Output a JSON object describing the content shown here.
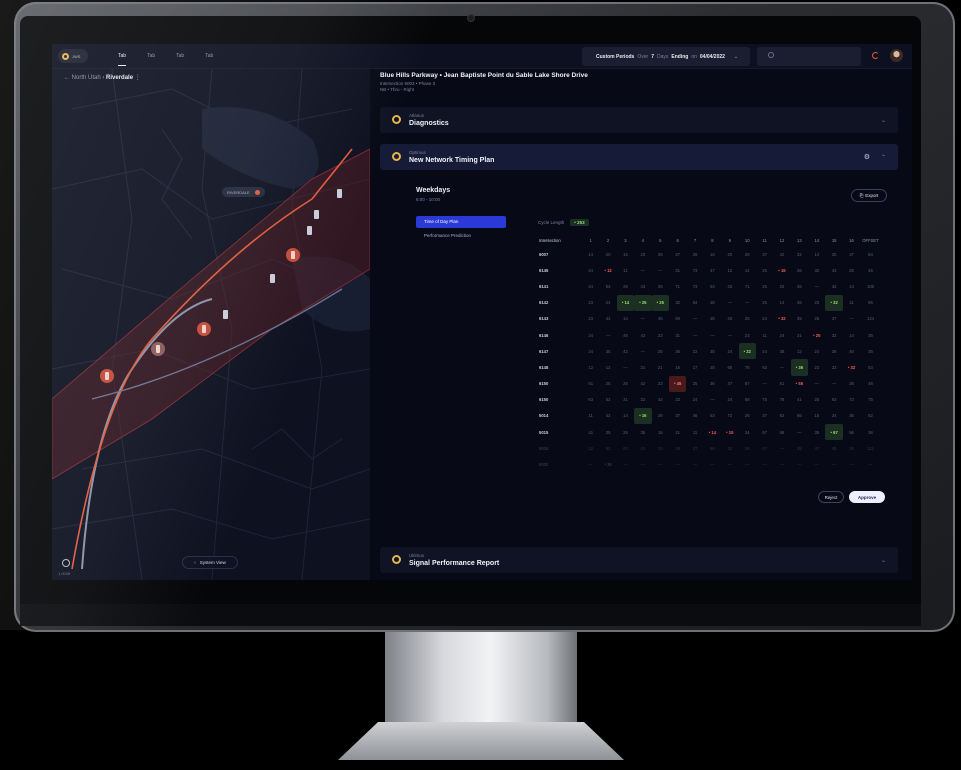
{
  "topbar": {
    "logo_text": "JWS",
    "tabs": [
      "Tab",
      "Tab",
      "Tab",
      "Tab"
    ],
    "period": {
      "label": "Custom Periods",
      "over": "Over",
      "days_value": "7",
      "days_unit": "Days",
      "ending": "Ending",
      "on": "on",
      "date": "04/04/2022"
    },
    "search_placeholder": ""
  },
  "map": {
    "breadcrumb_parent": "North Utah",
    "breadcrumb_current": "Riverdale",
    "region_label": "RIVERDALE",
    "system_view_button": "System View",
    "scale": "1,000ft"
  },
  "header": {
    "title": "Blue Hills Parkway  •  Jean Baptiste Point du Sable Lake Shore Drive",
    "subtitle1": "Intersection 5003  •  Phase 3",
    "subtitle2": "NB • Thru - Right"
  },
  "panels": [
    {
      "overline": "Atlanus",
      "title": "Diagnostics"
    },
    {
      "overline": "Optimus",
      "title": "New Network Timing Plan"
    },
    {
      "overline": "Ultimus",
      "title": "Signal Performance Report"
    }
  ],
  "plan": {
    "title": "Weekdays",
    "time": "6:00 - 10:00",
    "export_label": "Export",
    "side_items": [
      "Time of Day Plan",
      "Performance Prediction"
    ],
    "cycle_label": "Cycle Length",
    "cycle_value": "• 253",
    "columns": [
      "Intersection",
      "1",
      "2",
      "3",
      "4",
      "5",
      "6",
      "7",
      "8",
      "9",
      "10",
      "11",
      "12",
      "13",
      "14",
      "15",
      "16",
      "OFFSET"
    ],
    "rows": [
      [
        "6007",
        "14",
        "20",
        "15",
        "23",
        "26",
        "27",
        "28",
        "15",
        "20",
        "26",
        "37",
        "42",
        "32",
        "14",
        "25",
        "37",
        "64"
      ],
      [
        "6145",
        "24",
        "• 12",
        "11",
        "—",
        "—",
        "31",
        "73",
        "47",
        "12",
        "14",
        "25",
        "• 15",
        "26",
        "32",
        "43",
        "25",
        "46"
      ],
      [
        "6141",
        "24",
        "53",
        "26",
        "43",
        "26",
        "71",
        "73",
        "64",
        "25",
        "71",
        "25",
        "25",
        "46",
        "—",
        "42",
        "14",
        "105"
      ],
      [
        "6142",
        "23",
        "24",
        "• 14",
        "• 25",
        "• 25",
        "32",
        "64",
        "26",
        "—",
        "—",
        "25",
        "14",
        "46",
        "23",
        "• 32",
        "11",
        "95"
      ],
      [
        "6143",
        "23",
        "42",
        "14",
        "—",
        "46",
        "69",
        "—",
        "25",
        "26",
        "25",
        "24",
        "• 32",
        "35",
        "26",
        "37",
        "—",
        "124"
      ],
      [
        "6146",
        "24",
        "—",
        "46",
        "43",
        "23",
        "31",
        "—",
        "—",
        "—",
        "23",
        "11",
        "24",
        "31",
        "• 25",
        "32",
        "14",
        "35"
      ],
      [
        "6147",
        "24",
        "35",
        "42",
        "—",
        "25",
        "36",
        "22",
        "35",
        "24",
        "• 22",
        "24",
        "35",
        "12",
        "24",
        "36",
        "46",
        "35"
      ],
      [
        "6148",
        "12",
        "12",
        "—",
        "31",
        "21",
        "16",
        "17",
        "28",
        "65",
        "75",
        "62",
        "—",
        "• 36",
        "23",
        "22",
        "• 32",
        "53"
      ],
      [
        "6150",
        "61",
        "25",
        "26",
        "42",
        "23",
        "• 45",
        "25",
        "36",
        "47",
        "67",
        "—",
        "61",
        "• 55",
        "—",
        "—",
        "28",
        "46"
      ],
      [
        "6150",
        "63",
        "52",
        "31",
        "22",
        "42",
        "33",
        "24",
        "—",
        "24",
        "56",
        "75",
        "78",
        "41",
        "25",
        "63",
        "73",
        "75"
      ],
      [
        "5014",
        "11",
        "42",
        "14",
        "• 16",
        "26",
        "37",
        "46",
        "63",
        "72",
        "26",
        "37",
        "62",
        "66",
        "15",
        "24",
        "35",
        "52"
      ],
      [
        "5015",
        "41",
        "35",
        "25",
        "36",
        "15",
        "21",
        "11",
        "• 14",
        "• 15",
        "34",
        "67",
        "68",
        "—",
        "35",
        "• 67",
        "56",
        "36"
      ],
      [
        "5016",
        "12",
        "52",
        "63",
        "41",
        "15",
        "26",
        "37",
        "66",
        "23",
        "26",
        "47",
        "—",
        "35",
        "47",
        "46",
        "35",
        "111"
      ],
      [
        "5020",
        "—",
        "• 36",
        "—",
        "—",
        "—",
        "—",
        "—",
        "—",
        "—",
        "—",
        "—",
        "—",
        "—",
        "—",
        "—",
        "—",
        "—"
      ]
    ],
    "reject_label": "Reject",
    "approve_label": "Approve"
  },
  "colors": {
    "accent": "#2b3ad6",
    "positive": "#9be06a",
    "negative": "#ff5a5a",
    "brand": "#e8b54a",
    "route": "#e05a3a"
  }
}
